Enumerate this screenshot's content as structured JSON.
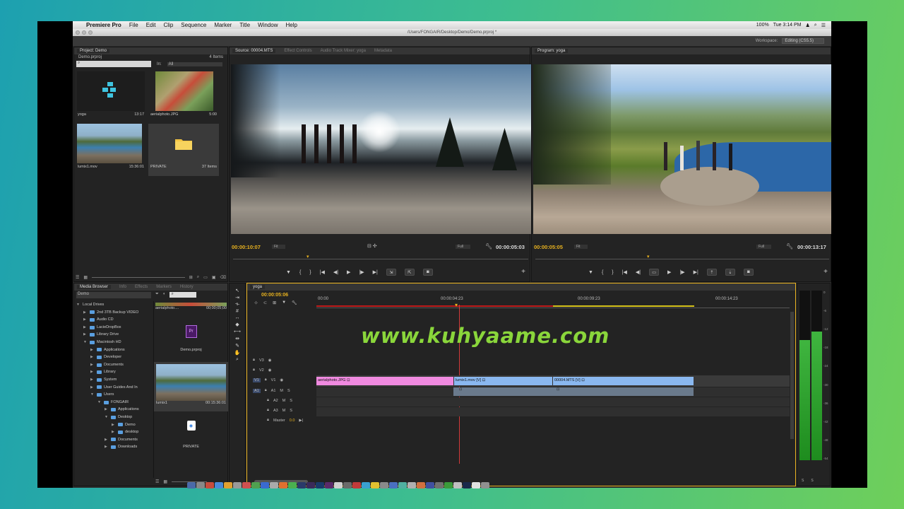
{
  "menubar": {
    "apple": "",
    "app": "Premiere Pro",
    "items": [
      "File",
      "Edit",
      "Clip",
      "Sequence",
      "Marker",
      "Title",
      "Window",
      "Help"
    ],
    "status_right": "100%",
    "clock": "Tue 3:14 PM"
  },
  "titlebar": {
    "path": "/Users/FONGAIR/Desktop/Demo/Demo.prproj *"
  },
  "workspace": {
    "label": "Workspace:",
    "value": "Editing (CS5.5)"
  },
  "project": {
    "tab": "Project: Demo",
    "file": "Demo.prproj",
    "items_count": "4 Items",
    "in_label": "In:",
    "in_value": "All",
    "items": [
      {
        "name": "yoga",
        "meta": "13:17"
      },
      {
        "name": "aerialphoto.JPG",
        "meta": "5:00"
      },
      {
        "name": "lumix1.mov",
        "meta": "15:36:01"
      },
      {
        "name": "PRIVATE",
        "meta": "37 Items"
      }
    ]
  },
  "source": {
    "tabs": [
      "Source: 00004.MTS",
      "Effect Controls",
      "Audio Track Mixer: yoga",
      "Metadata"
    ],
    "timecode_in": "00:00:10:07",
    "fit": "Fit",
    "quality": "Full",
    "timecode_dur": "00:00:05:03"
  },
  "program": {
    "tab": "Program: yoga",
    "timecode_in": "00:00:05:05",
    "fit": "Fit",
    "quality": "Full",
    "timecode_dur": "00:00:13:17"
  },
  "media_browser": {
    "tabs": [
      "Media Browser",
      "Info",
      "Effects",
      "Markers",
      "History"
    ],
    "select": "Demo",
    "tree": [
      {
        "label": "Local Drives",
        "indent": 0,
        "tri": "▼",
        "folder": false
      },
      {
        "label": "2nd 3TB Backup VIDEO",
        "indent": 1,
        "tri": "▶",
        "folder": true
      },
      {
        "label": "Audio CD",
        "indent": 1,
        "tri": "▶",
        "folder": true
      },
      {
        "label": "LacieDropBox",
        "indent": 1,
        "tri": "▶",
        "folder": true
      },
      {
        "label": "Library Drive",
        "indent": 1,
        "tri": "▶",
        "folder": true
      },
      {
        "label": "Macintosh HD",
        "indent": 1,
        "tri": "▼",
        "folder": true
      },
      {
        "label": "Applications",
        "indent": 2,
        "tri": "▶",
        "folder": true
      },
      {
        "label": "Developer",
        "indent": 2,
        "tri": "▶",
        "folder": true
      },
      {
        "label": "Documents",
        "indent": 2,
        "tri": "▶",
        "folder": true
      },
      {
        "label": "Library",
        "indent": 2,
        "tri": "▶",
        "folder": true
      },
      {
        "label": "System",
        "indent": 2,
        "tri": "▶",
        "folder": true
      },
      {
        "label": "User Guides And In",
        "indent": 2,
        "tri": "▶",
        "folder": true
      },
      {
        "label": "Users",
        "indent": 2,
        "tri": "▼",
        "folder": true
      },
      {
        "label": "FONGAIR",
        "indent": 3,
        "tri": "▼",
        "folder": true
      },
      {
        "label": "Applications",
        "indent": 4,
        "tri": "▶",
        "folder": true
      },
      {
        "label": "Desktop",
        "indent": 4,
        "tri": "▼",
        "folder": true
      },
      {
        "label": "Demo",
        "indent": 5,
        "tri": "▶",
        "folder": true
      },
      {
        "label": "desktop",
        "indent": 5,
        "tri": "▶",
        "folder": true
      },
      {
        "label": "Documents",
        "indent": 4,
        "tri": "▶",
        "folder": true
      },
      {
        "label": "Downloads",
        "indent": 4,
        "tri": "▶",
        "folder": true
      }
    ],
    "files": [
      {
        "name": "aerialphoto....",
        "meta": "00;00;05;00"
      },
      {
        "name": "Demo.prproj",
        "meta": ""
      },
      {
        "name": "lumix1",
        "meta": "00:15:36:01"
      },
      {
        "name": "PRIVATE",
        "meta": ""
      }
    ]
  },
  "timeline": {
    "tab": "yoga",
    "timecode": "00:00:05:06",
    "ruler": [
      "00:00",
      "00:00:04:23",
      "00:00:09:23",
      "00:00:14:23"
    ],
    "tracks": [
      {
        "label": "V3"
      },
      {
        "label": "V2"
      },
      {
        "label": "V1"
      },
      {
        "label": "A1"
      },
      {
        "label": "A2"
      },
      {
        "label": "A3"
      }
    ],
    "master_label": "Master",
    "master_value": "0.0",
    "clips": [
      {
        "name": "aerialphoto.JPG",
        "color": "#f08ae0"
      },
      {
        "name": "lumix1.mov [V]",
        "color": "#8ab8f0"
      },
      {
        "name": "00004.MTS [V]",
        "color": "#8ab8f0"
      }
    ]
  },
  "meter_scale": [
    "0",
    "-6",
    "-12",
    "-18",
    "-24",
    "-30",
    "-36",
    "-42",
    "-48",
    "-54"
  ],
  "watermark": "www.kuhyaame.com"
}
